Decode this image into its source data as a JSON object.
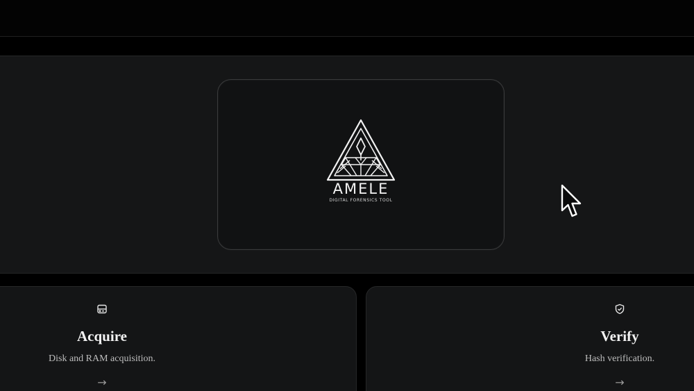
{
  "brand": {
    "name": "AMELE",
    "tagline": "DIGITAL FORENSICS TOOL"
  },
  "features": [
    {
      "title": "Acquire",
      "description": "Disk and RAM acquisition.",
      "icon": "hard-drive-icon",
      "arrow": "→"
    },
    {
      "title": "Verify",
      "description": "Hash verification.",
      "icon": "shield-check-icon",
      "arrow": "→"
    }
  ],
  "colors": {
    "background": "#000000",
    "panel": "#151617",
    "card": "#111213",
    "text": "#f2f2f2",
    "muted": "#bdbdbd"
  }
}
